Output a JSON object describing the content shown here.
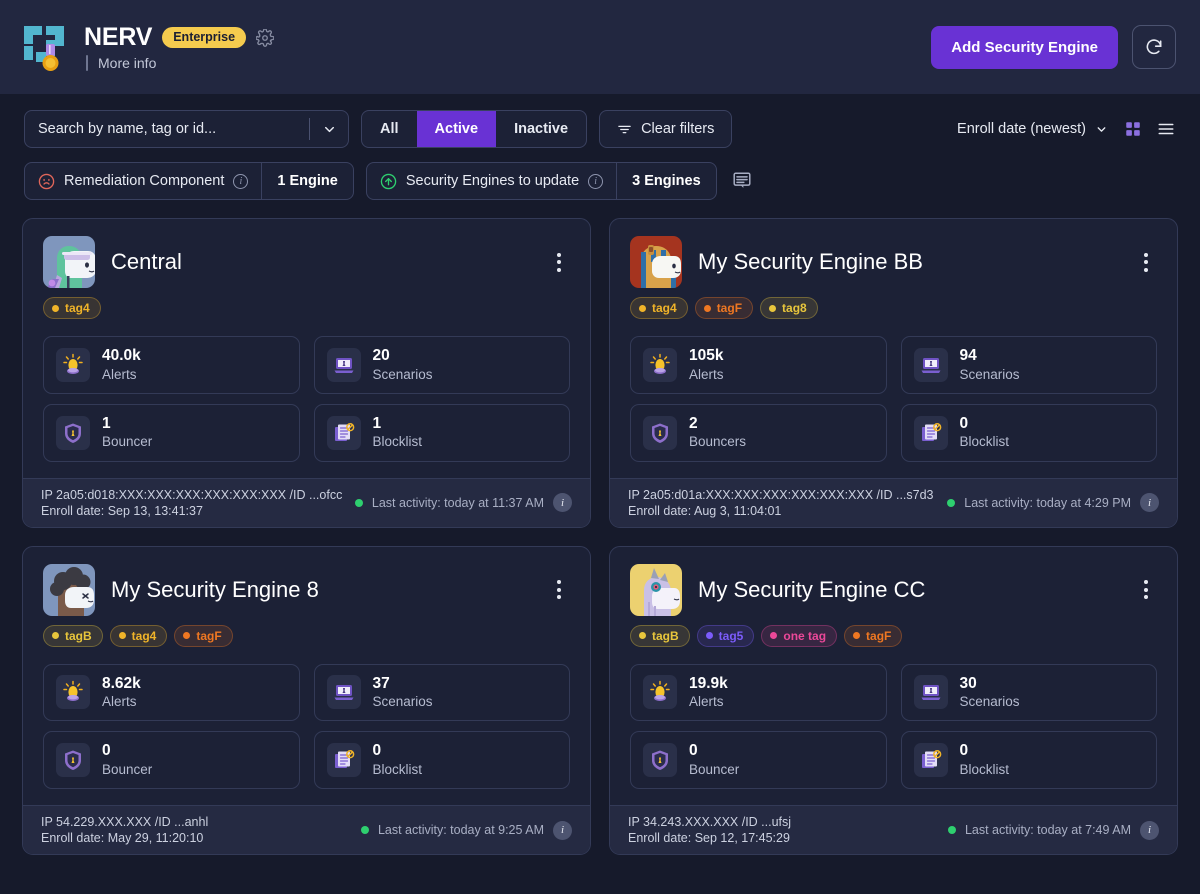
{
  "header": {
    "brand_name": "NERV",
    "badge": "Enterprise",
    "more_info": "More info",
    "gear_icon": "gear-icon",
    "add_button": "Add Security Engine",
    "refresh_icon": "refresh-icon",
    "accent": "#6932d4",
    "badge_color": "#f5cb4e"
  },
  "toolbar": {
    "search_placeholder": "Search by name, tag or id...",
    "search_value": "",
    "chevron_icon": "chevron-down-icon",
    "segments": [
      {
        "label": "All",
        "active": false
      },
      {
        "label": "Active",
        "active": true
      },
      {
        "label": "Inactive",
        "active": false
      }
    ],
    "clear_filters": "Clear filters",
    "filter_icon": "filter-icon",
    "sort_label": "Enroll date (newest)",
    "grid_view_icon": "grid-view-icon",
    "list_view_icon": "list-view-icon"
  },
  "pills": [
    {
      "label": "Remediation Component",
      "count": "1 Engine",
      "icon": "sad-face-icon",
      "icon_color": "#e0665a"
    },
    {
      "label": "Security Engines to update",
      "count": "3 Engines",
      "icon": "arrow-up-circle-icon",
      "icon_color": "#2ecf6f"
    }
  ],
  "pill_extra_icon": "console-log-icon",
  "cards": [
    {
      "name": "Central",
      "avatar": "avatar-scientist-llama",
      "tags": [
        {
          "label": "tag4",
          "color": "#f0b429"
        }
      ],
      "stats": [
        {
          "value": "40.0k",
          "label": "Alerts",
          "icon": "alert-lamp-icon"
        },
        {
          "value": "20",
          "label": "Scenarios",
          "icon": "scenario-laptop-icon"
        },
        {
          "value": "1",
          "label": "Bouncer",
          "icon": "bouncer-shield-icon"
        },
        {
          "value": "1",
          "label": "Blocklist",
          "icon": "blocklist-doc-icon"
        }
      ],
      "ip": "IP 2a05:d018:XXX:XXX:XXX:XXX:XXX:XXX /ID ...ofcc",
      "enroll": "Enroll date: Sep 13, 13:41:37",
      "last_activity": "Last activity: today at 11:37 AM",
      "status": "online"
    },
    {
      "name": "My Security Engine BB",
      "avatar": "avatar-pharaoh-llama",
      "tags": [
        {
          "label": "tag4",
          "color": "#f0b429"
        },
        {
          "label": "tagF",
          "color": "#ef7722"
        },
        {
          "label": "tag8",
          "color": "#e8c63c"
        }
      ],
      "stats": [
        {
          "value": "105k",
          "label": "Alerts",
          "icon": "alert-lamp-icon"
        },
        {
          "value": "94",
          "label": "Scenarios",
          "icon": "scenario-laptop-icon"
        },
        {
          "value": "2",
          "label": "Bouncers",
          "icon": "bouncer-shield-icon"
        },
        {
          "value": "0",
          "label": "Blocklist",
          "icon": "blocklist-doc-icon"
        }
      ],
      "ip": "IP 2a05:d01a:XXX:XXX:XXX:XXX:XXX:XXX /ID ...s7d3",
      "enroll": "Enroll date: Aug 3, 11:04:01",
      "last_activity": "Last activity: today at 4:29 PM",
      "status": "online"
    },
    {
      "name": "My Security Engine 8",
      "avatar": "avatar-afro-llama",
      "tags": [
        {
          "label": "tagB",
          "color": "#e8c63c"
        },
        {
          "label": "tag4",
          "color": "#f0b429"
        },
        {
          "label": "tagF",
          "color": "#ef7722"
        }
      ],
      "stats": [
        {
          "value": "8.62k",
          "label": "Alerts",
          "icon": "alert-lamp-icon"
        },
        {
          "value": "37",
          "label": "Scenarios",
          "icon": "scenario-laptop-icon"
        },
        {
          "value": "0",
          "label": "Bouncer",
          "icon": "bouncer-shield-icon"
        },
        {
          "value": "0",
          "label": "Blocklist",
          "icon": "blocklist-doc-icon"
        }
      ],
      "ip": "IP 54.229.XXX.XXX /ID ...anhl",
      "enroll": "Enroll date: May 29, 11:20:10",
      "last_activity": "Last activity: today at 9:25 AM",
      "status": "online"
    },
    {
      "name": "My Security Engine CC",
      "avatar": "avatar-unicorn-llama",
      "tags": [
        {
          "label": "tagB",
          "color": "#e8c63c"
        },
        {
          "label": "tag5",
          "color": "#7b5cfa"
        },
        {
          "label": "one tag",
          "color": "#ec4899"
        },
        {
          "label": "tagF",
          "color": "#ef7722"
        }
      ],
      "stats": [
        {
          "value": "19.9k",
          "label": "Alerts",
          "icon": "alert-lamp-icon"
        },
        {
          "value": "30",
          "label": "Scenarios",
          "icon": "scenario-laptop-icon"
        },
        {
          "value": "0",
          "label": "Bouncer",
          "icon": "bouncer-shield-icon"
        },
        {
          "value": "0",
          "label": "Blocklist",
          "icon": "blocklist-doc-icon"
        }
      ],
      "ip": "IP 34.243.XXX.XXX /ID ...ufsj",
      "enroll": "Enroll date: Sep 12, 17:45:29",
      "last_activity": "Last activity: today at 7:49 AM",
      "status": "online"
    }
  ]
}
